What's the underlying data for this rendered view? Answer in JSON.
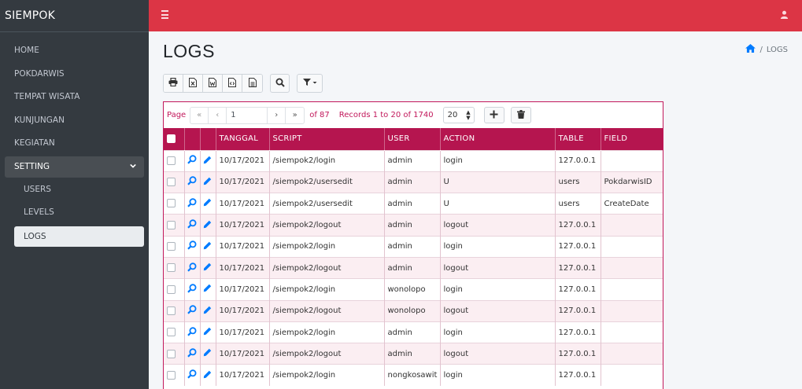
{
  "brand": "SIEMPOK",
  "sidebar": {
    "items": [
      {
        "label": "HOME"
      },
      {
        "label": "POKDARWIS"
      },
      {
        "label": "TEMPAT WISATA"
      },
      {
        "label": "KUNJUNGAN"
      },
      {
        "label": "KEGIATAN"
      },
      {
        "label": "SETTING"
      }
    ],
    "setting_children": [
      {
        "label": "USERS"
      },
      {
        "label": "LEVELS"
      },
      {
        "label": "LOGS"
      }
    ]
  },
  "page": {
    "title": "LOGS",
    "breadcrumb": "LOGS"
  },
  "pager": {
    "page_label": "Page",
    "current_page": "1",
    "of_label": "of 87",
    "records_label": "Records 1 to 20 of 1740",
    "page_size": "20"
  },
  "table": {
    "columns": [
      "TANGGAL",
      "SCRIPT",
      "USER",
      "ACTION",
      "TABLE",
      "FIELD"
    ],
    "rows": [
      {
        "tanggal": "10/17/2021",
        "script": "/siempok2/login",
        "user": "admin",
        "action": "login",
        "table": "127.0.0.1",
        "field": ""
      },
      {
        "tanggal": "10/17/2021",
        "script": "/siempok2/usersedit",
        "user": "admin",
        "action": "U",
        "table": "users",
        "field": "PokdarwisID"
      },
      {
        "tanggal": "10/17/2021",
        "script": "/siempok2/usersedit",
        "user": "admin",
        "action": "U",
        "table": "users",
        "field": "CreateDate"
      },
      {
        "tanggal": "10/17/2021",
        "script": "/siempok2/logout",
        "user": "admin",
        "action": "logout",
        "table": "127.0.0.1",
        "field": ""
      },
      {
        "tanggal": "10/17/2021",
        "script": "/siempok2/login",
        "user": "admin",
        "action": "login",
        "table": "127.0.0.1",
        "field": ""
      },
      {
        "tanggal": "10/17/2021",
        "script": "/siempok2/logout",
        "user": "admin",
        "action": "logout",
        "table": "127.0.0.1",
        "field": ""
      },
      {
        "tanggal": "10/17/2021",
        "script": "/siempok2/login",
        "user": "wonolopo",
        "action": "login",
        "table": "127.0.0.1",
        "field": ""
      },
      {
        "tanggal": "10/17/2021",
        "script": "/siempok2/logout",
        "user": "wonolopo",
        "action": "logout",
        "table": "127.0.0.1",
        "field": ""
      },
      {
        "tanggal": "10/17/2021",
        "script": "/siempok2/login",
        "user": "admin",
        "action": "login",
        "table": "127.0.0.1",
        "field": ""
      },
      {
        "tanggal": "10/17/2021",
        "script": "/siempok2/logout",
        "user": "admin",
        "action": "logout",
        "table": "127.0.0.1",
        "field": ""
      },
      {
        "tanggal": "10/17/2021",
        "script": "/siempok2/login",
        "user": "nongkosawit",
        "action": "login",
        "table": "127.0.0.1",
        "field": ""
      }
    ]
  },
  "colors": {
    "header": "#dc3545",
    "sidebar": "#343a40",
    "table_header": "#b5154f",
    "accent_icon": "#007bff"
  },
  "icons": {
    "toolbar": [
      "print-icon",
      "excel-icon",
      "word-icon",
      "html-icon",
      "csv-icon",
      "search-icon",
      "filter-icon"
    ],
    "row": [
      "view-icon",
      "edit-icon"
    ]
  }
}
